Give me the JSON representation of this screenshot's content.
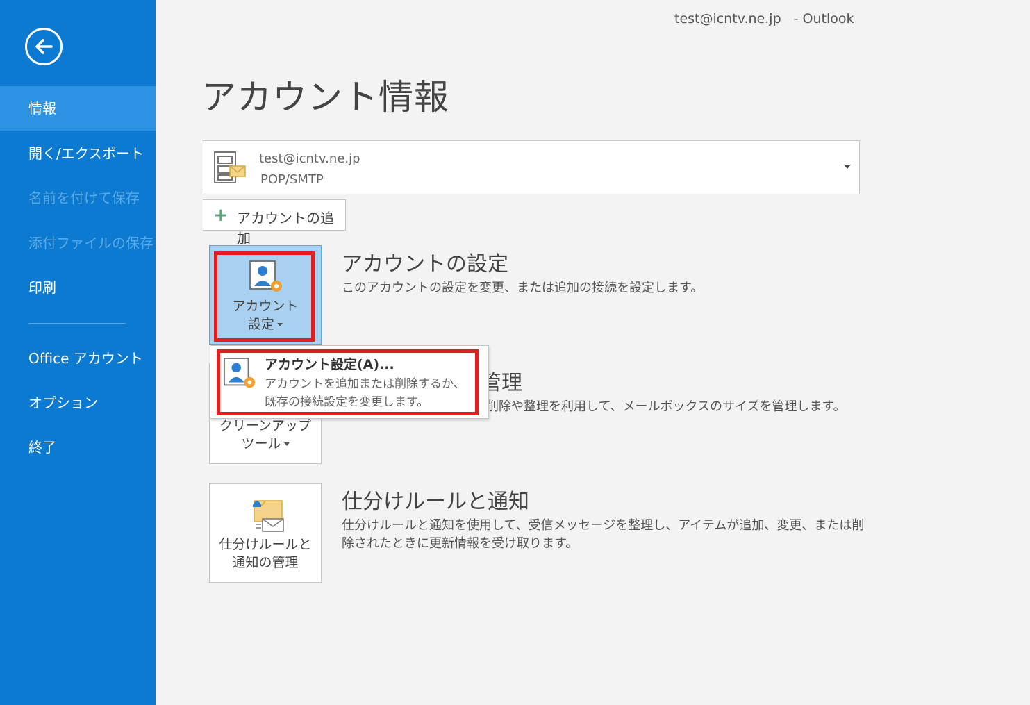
{
  "window": {
    "account": "test@icntv.ne.jp",
    "app": "- Outlook"
  },
  "sidebar": {
    "items": [
      {
        "label": "情報"
      },
      {
        "label": "開く/エクスポート"
      },
      {
        "label": "名前を付けて保存"
      },
      {
        "label": "添付ファイルの保存"
      },
      {
        "label": "印刷"
      },
      {
        "label": "Office アカウント"
      },
      {
        "label": "オプション"
      },
      {
        "label": "終了"
      }
    ]
  },
  "main": {
    "title": "アカウント情報",
    "account": {
      "email": "test@icntv.ne.jp",
      "type": "POP/SMTP"
    },
    "add_account": "アカウントの追加",
    "account_settings": {
      "button_line1": "アカウント",
      "button_line2": "設定",
      "title": "アカウントの設定",
      "desc": "このアカウントの設定を変更、または追加の接続を設定します。"
    },
    "cleanup": {
      "button_line1": "クリーンアップ",
      "button_line2": "ツール",
      "title_fragment": "管理",
      "desc_fragment": "削除や整理を利用して、メールボックスのサイズを管理します。"
    },
    "rules": {
      "button_line1": "仕分けルールと",
      "button_line2": "通知の管理",
      "title": "仕分けルールと通知",
      "desc_line1": "仕分けルールと通知を使用して、受信メッセージを整理し、アイテムが追加、変更、または削",
      "desc_line2": "除されたときに更新情報を受け取ります。"
    }
  },
  "menu": {
    "item_title": "アカウント設定(A)...",
    "item_desc_line1": "アカウントを追加または削除するか、",
    "item_desc_line2": "既存の接続設定を変更します。"
  },
  "colors": {
    "sidebar": "#0c7ad0",
    "active_item": "#2b93e2",
    "highlight": "#e02020",
    "selected_button": "#a8d0f0"
  }
}
